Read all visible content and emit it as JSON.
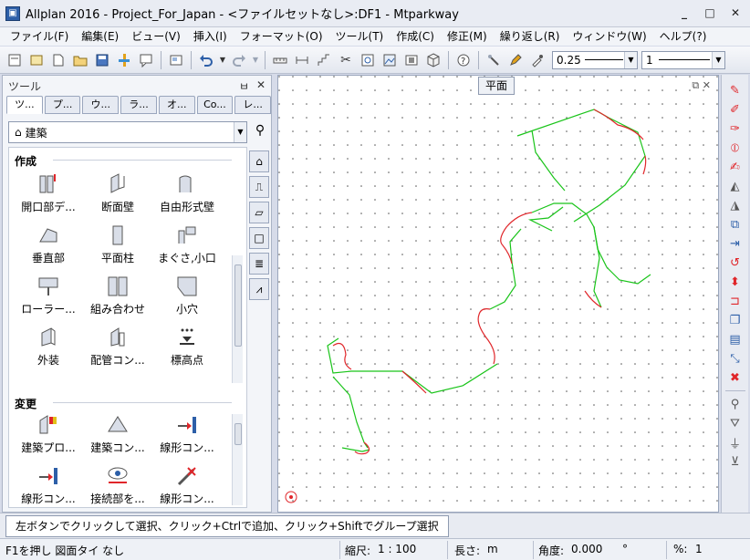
{
  "window": {
    "title": "Allplan 2016 - Project_For_Japan - <ファイルセットなし>:DF1 - Mtparkway",
    "minimize": "_",
    "maximize": "□",
    "close": "✕"
  },
  "menu": [
    "ファイル(F)",
    "編集(E)",
    "ビュー(V)",
    "挿入(I)",
    "フォーマット(O)",
    "ツール(T)",
    "作成(C)",
    "修正(M)",
    "繰り返し(R)",
    "ウィンドウ(W)",
    "ヘルプ(?)"
  ],
  "toolbar": {
    "pen_value": "0.25",
    "line_value": "1"
  },
  "panel": {
    "title": "ツール",
    "pin": "ㅂ",
    "close": "✕",
    "tabs": [
      "ツ...",
      "プ...",
      "ウ...",
      "ラ...",
      "オ...",
      "Co...",
      "レ..."
    ],
    "category": "建築",
    "sections": {
      "create": {
        "title": "作成",
        "tools": [
          "開口部デ...",
          "断面壁",
          "自由形式壁",
          "垂直部",
          "平面柱",
          "まぐさ,小口",
          "ローラー...",
          "組み合わせ",
          "小穴",
          "外装",
          "配管コン...",
          "標高点"
        ]
      },
      "modify": {
        "title": "変更",
        "tools": [
          "建築プロ...",
          "建築コン...",
          "線形コン...",
          "線形コン...",
          "接続部を...",
          "線形コン..."
        ]
      }
    }
  },
  "canvas": {
    "view_label": "平面",
    "view_controls": "⧉ ✕"
  },
  "colors": {
    "green": "#19c419",
    "red": "#e0262a",
    "accent": "#2d5fa8"
  },
  "hint": "左ボタンでクリックして選択、クリック+Ctrlで追加、クリック+Shiftでグループ選択",
  "status": {
    "help": "F1を押し 図面タイ なし",
    "scale_label": "縮尺:",
    "scale_value": "1 : 100",
    "length_label": "長さ:",
    "length_value": "m",
    "angle_label": "角度:",
    "angle_value": "0.000",
    "angle_unit": "°",
    "percent_label": "%:",
    "percent_value": "1"
  }
}
